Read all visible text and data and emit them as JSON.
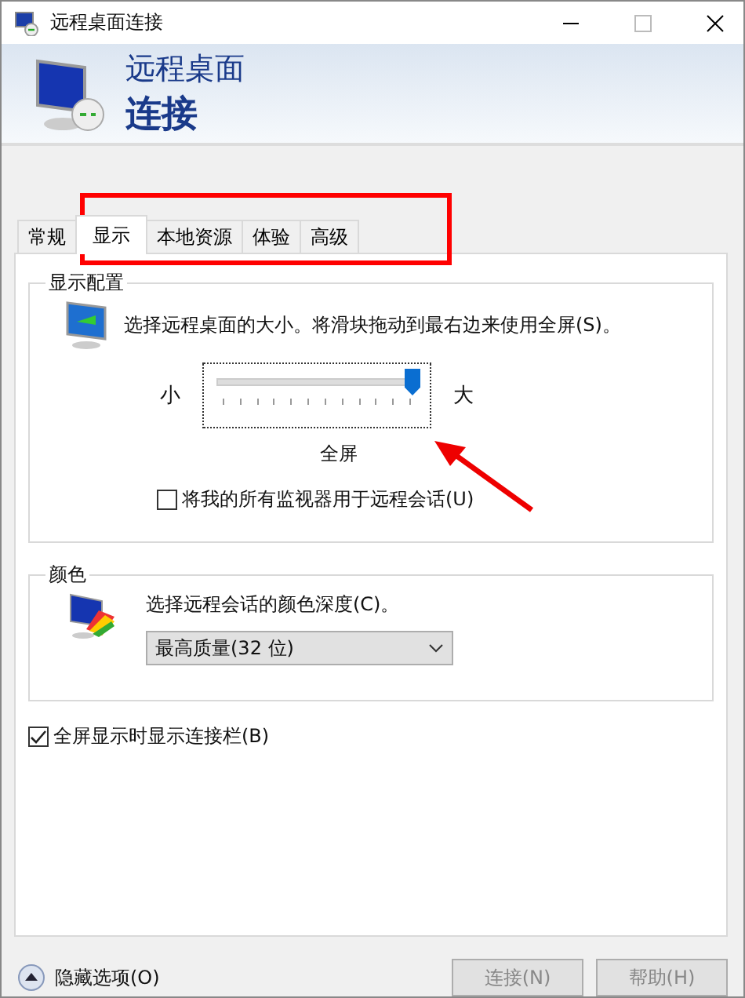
{
  "window": {
    "title": "远程桌面连接"
  },
  "banner": {
    "line1": "远程桌面",
    "line2": "连接"
  },
  "tabs": [
    {
      "label": "常规",
      "selected": false
    },
    {
      "label": "显示",
      "selected": true
    },
    {
      "label": "本地资源",
      "selected": false
    },
    {
      "label": "体验",
      "selected": false
    },
    {
      "label": "高级",
      "selected": false
    }
  ],
  "display_group": {
    "title": "显示配置",
    "description": "选择远程桌面的大小。将滑块拖动到最右边来使用全屏(S)。",
    "slider": {
      "min_label": "小",
      "max_label": "大",
      "level": 1.0,
      "reading": "全屏"
    },
    "all_monitors": {
      "label": "将我的所有监视器用于远程会话(U)",
      "checked": false
    }
  },
  "color_group": {
    "title": "颜色",
    "description": "选择远程会话的颜色深度(C)。",
    "dropdown": {
      "value": "最高质量(32 位)"
    }
  },
  "show_connection_bar": {
    "label": "全屏显示时显示连接栏(B)",
    "checked": true
  },
  "footer": {
    "toggle": "隐藏选项(O)",
    "buttons": [
      "连接(N)",
      "帮助(H)"
    ]
  }
}
